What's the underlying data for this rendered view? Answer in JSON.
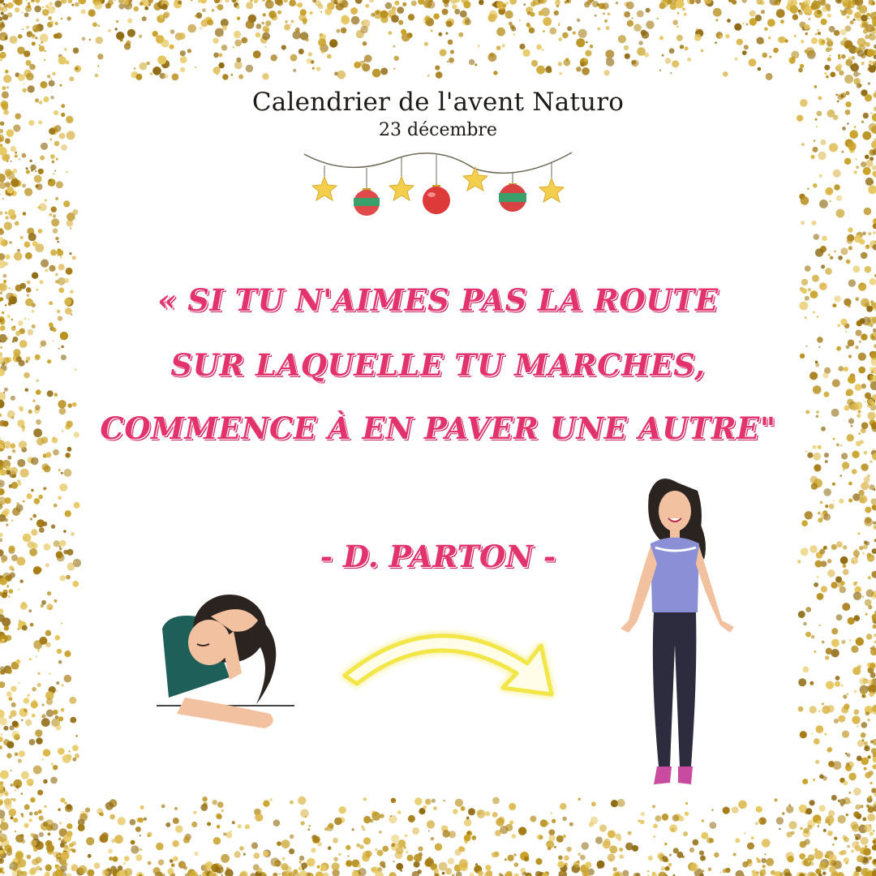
{
  "header": {
    "title": "Calendrier de l'avent Naturo",
    "date": "23 décembre"
  },
  "quote": {
    "line1": "« SI TU N'AIMES PAS LA ROUTE",
    "line2": "SUR LAQUELLE TU MARCHES,",
    "line3": "COMMENCE À EN PAVER UNE AUTRE\"",
    "author": "- D. PARTON -"
  },
  "colors": {
    "accent": "#e3336d",
    "gold": "#c9a227",
    "text": "#1e1a18",
    "arrow": "#f2e64a"
  },
  "decorations": {
    "border": "gold-glitter-frame",
    "garland": "christmas-garland-stars-baubles",
    "left_illustration": "sad-woman-at-desk",
    "right_illustration": "happy-standing-woman",
    "center_illustration": "curved-arrow-right"
  }
}
